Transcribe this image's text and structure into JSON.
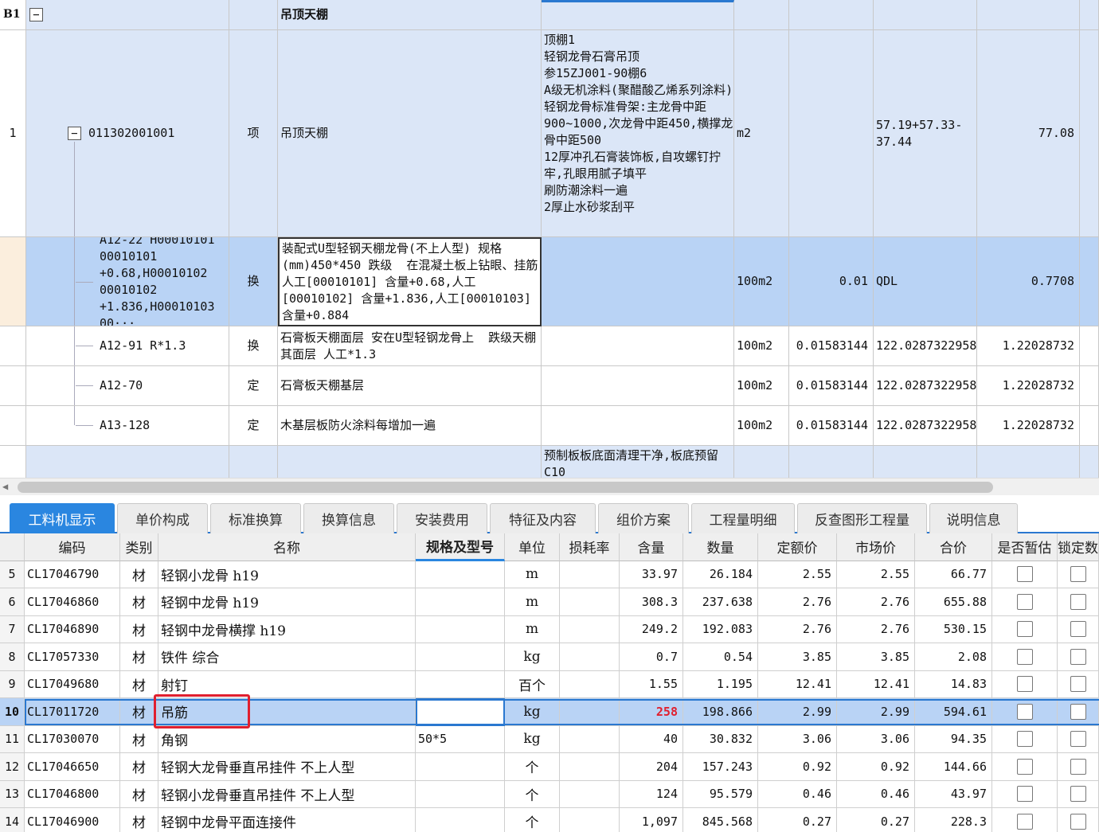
{
  "top_grid": {
    "b1_label": "B1",
    "b1_collapse": "−",
    "b1_title": "吊顶天棚",
    "rows": [
      {
        "num": "1",
        "code": "011302001001",
        "type": "项",
        "name": "吊顶天棚",
        "features": "顶棚1\n轻钢龙骨石膏吊顶\n参15ZJ001-90棚6\nA级无机涂料(聚醋酸乙烯系列涂料)\n轻钢龙骨标准骨架:主龙骨中距900~1000,次龙骨中距450,横撑龙骨中距500\n12厚冲孔石膏装饰板,自攻螺钉拧牢,孔眼用腻子填平\n刷防潮涂料一遍\n2厚止水砂浆刮平",
        "unit": "m2",
        "qty_expr": "57.19+57.33-37.44",
        "total": "77.08"
      },
      {
        "num": "",
        "code": "A12-22 H00010101\n00010101\n+0.68,H00010102\n00010102\n+1.836,H00010103 00···",
        "type": "换",
        "name": "装配式U型轻钢天棚龙骨(不上人型) 规格(mm)450*450 跌级  在混凝土板上钻眼、挂筋 人工[00010101] 含量+0.68,人工[00010102] 含量+1.836,人工[00010103] 含量+0.884",
        "features": "",
        "unit": "100m2",
        "factor": "0.01",
        "qty_expr": "QDL",
        "total": "0.7708"
      },
      {
        "num": "",
        "code": "A12-91 R*1.3",
        "type": "换",
        "name": "石膏板天棚面层 安在U型轻钢龙骨上  跌级天棚其面层 人工*1.3",
        "features": "",
        "unit": "100m2",
        "factor": "0.01583144",
        "qty_expr": "122.028732295856",
        "total": "1.22028732"
      },
      {
        "num": "",
        "code": "A12-70",
        "type": "定",
        "name": "石膏板天棚基层",
        "features": "",
        "unit": "100m2",
        "factor": "0.01583144",
        "qty_expr": "122.028732295856",
        "total": "1.22028732"
      },
      {
        "num": "",
        "code": "A13-128",
        "type": "定",
        "name": "木基层板防火涂料每增加一遍",
        "features": "",
        "unit": "100m2",
        "factor": "0.01583144",
        "qty_expr": "122.028732295856",
        "total": "1.22028732"
      },
      {
        "num": "",
        "code": "",
        "type": "",
        "name": "",
        "features": "预制板板底面清理干净,板底预留C10",
        "unit": "",
        "factor": "",
        "qty_expr": "",
        "total": ""
      }
    ]
  },
  "tabs": [
    {
      "label": "工料机显示",
      "active": true
    },
    {
      "label": "单价构成"
    },
    {
      "label": "标准换算"
    },
    {
      "label": "换算信息"
    },
    {
      "label": "安装费用"
    },
    {
      "label": "特征及内容"
    },
    {
      "label": "组价方案"
    },
    {
      "label": "工程量明细"
    },
    {
      "label": "反查图形工程量"
    },
    {
      "label": "说明信息"
    }
  ],
  "lower_grid": {
    "headers": [
      "",
      "编码",
      "类别",
      "名称",
      "规格及型号",
      "单位",
      "损耗率",
      "含量",
      "数量",
      "定额价",
      "市场价",
      "合价",
      "是否暂估",
      "锁定数"
    ],
    "rows": [
      {
        "idx": "5",
        "code": "CL17046790",
        "cat": "材",
        "name": "轻钢小龙骨 h19",
        "spec": "",
        "unit": "m",
        "loss": "",
        "content": "33.97",
        "qty": "26.184",
        "quota_price": "2.55",
        "market_price": "2.55",
        "total": "66.77"
      },
      {
        "idx": "6",
        "code": "CL17046860",
        "cat": "材",
        "name": "轻钢中龙骨 h19",
        "spec": "",
        "unit": "m",
        "loss": "",
        "content": "308.3",
        "qty": "237.638",
        "quota_price": "2.76",
        "market_price": "2.76",
        "total": "655.88"
      },
      {
        "idx": "7",
        "code": "CL17046890",
        "cat": "材",
        "name": "轻钢中龙骨横撑 h19",
        "spec": "",
        "unit": "m",
        "loss": "",
        "content": "249.2",
        "qty": "192.083",
        "quota_price": "2.76",
        "market_price": "2.76",
        "total": "530.15"
      },
      {
        "idx": "8",
        "code": "CL17057330",
        "cat": "材",
        "name": "铁件 综合",
        "spec": "",
        "unit": "kg",
        "loss": "",
        "content": "0.7",
        "qty": "0.54",
        "quota_price": "3.85",
        "market_price": "3.85",
        "total": "2.08"
      },
      {
        "idx": "9",
        "code": "CL17049680",
        "cat": "材",
        "name": "射钉",
        "spec": "",
        "unit": "百个",
        "loss": "",
        "content": "1.55",
        "qty": "1.195",
        "quota_price": "12.41",
        "market_price": "12.41",
        "total": "14.83"
      },
      {
        "idx": "10",
        "code": "CL17011720",
        "cat": "材",
        "name": "吊筋",
        "spec": "",
        "unit": "kg",
        "loss": "",
        "content": "258",
        "qty": "198.866",
        "quota_price": "2.99",
        "market_price": "2.99",
        "total": "594.61",
        "selected": true
      },
      {
        "idx": "11",
        "code": "CL17030070",
        "cat": "材",
        "name": "角钢",
        "spec": "50*5",
        "unit": "kg",
        "loss": "",
        "content": "40",
        "qty": "30.832",
        "quota_price": "3.06",
        "market_price": "3.06",
        "total": "94.35"
      },
      {
        "idx": "12",
        "code": "CL17046650",
        "cat": "材",
        "name": "轻钢大龙骨垂直吊挂件 不上人型",
        "spec": "",
        "unit": "个",
        "loss": "",
        "content": "204",
        "qty": "157.243",
        "quota_price": "0.92",
        "market_price": "0.92",
        "total": "144.66"
      },
      {
        "idx": "13",
        "code": "CL17046800",
        "cat": "材",
        "name": "轻钢小龙骨垂直吊挂件 不上人型",
        "spec": "",
        "unit": "个",
        "loss": "",
        "content": "124",
        "qty": "95.579",
        "quota_price": "0.46",
        "market_price": "0.46",
        "total": "43.97"
      },
      {
        "idx": "14",
        "code": "CL17046900",
        "cat": "材",
        "name": "轻钢中龙骨平面连接件",
        "spec": "",
        "unit": "个",
        "loss": "",
        "content": "1,097",
        "qty": "845.568",
        "quota_price": "0.27",
        "market_price": "0.27",
        "total": "228.3"
      }
    ]
  },
  "colors": {
    "accent": "#2a86e0",
    "highlight_red": "#e0202f",
    "row_blue": "#dbe6f7",
    "row_selected": "#b9d3f5"
  }
}
